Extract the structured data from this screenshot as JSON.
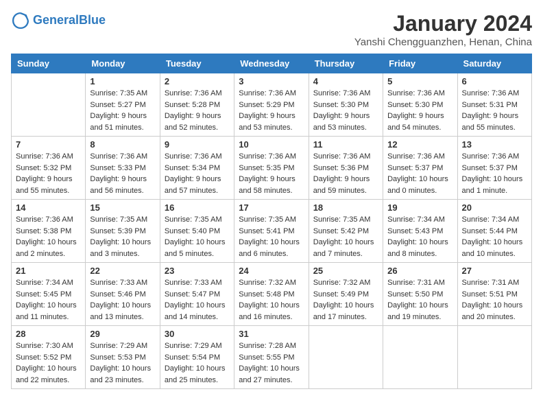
{
  "logo": {
    "text_general": "General",
    "text_blue": "Blue"
  },
  "title": "January 2024",
  "subtitle": "Yanshi Chengguanzhen, Henan, China",
  "days_of_week": [
    "Sunday",
    "Monday",
    "Tuesday",
    "Wednesday",
    "Thursday",
    "Friday",
    "Saturday"
  ],
  "weeks": [
    [
      {
        "day": "",
        "info": ""
      },
      {
        "day": "1",
        "info": "Sunrise: 7:35 AM\nSunset: 5:27 PM\nDaylight: 9 hours\nand 51 minutes."
      },
      {
        "day": "2",
        "info": "Sunrise: 7:36 AM\nSunset: 5:28 PM\nDaylight: 9 hours\nand 52 minutes."
      },
      {
        "day": "3",
        "info": "Sunrise: 7:36 AM\nSunset: 5:29 PM\nDaylight: 9 hours\nand 53 minutes."
      },
      {
        "day": "4",
        "info": "Sunrise: 7:36 AM\nSunset: 5:30 PM\nDaylight: 9 hours\nand 53 minutes."
      },
      {
        "day": "5",
        "info": "Sunrise: 7:36 AM\nSunset: 5:30 PM\nDaylight: 9 hours\nand 54 minutes."
      },
      {
        "day": "6",
        "info": "Sunrise: 7:36 AM\nSunset: 5:31 PM\nDaylight: 9 hours\nand 55 minutes."
      }
    ],
    [
      {
        "day": "7",
        "info": "Sunrise: 7:36 AM\nSunset: 5:32 PM\nDaylight: 9 hours\nand 55 minutes."
      },
      {
        "day": "8",
        "info": "Sunrise: 7:36 AM\nSunset: 5:33 PM\nDaylight: 9 hours\nand 56 minutes."
      },
      {
        "day": "9",
        "info": "Sunrise: 7:36 AM\nSunset: 5:34 PM\nDaylight: 9 hours\nand 57 minutes."
      },
      {
        "day": "10",
        "info": "Sunrise: 7:36 AM\nSunset: 5:35 PM\nDaylight: 9 hours\nand 58 minutes."
      },
      {
        "day": "11",
        "info": "Sunrise: 7:36 AM\nSunset: 5:36 PM\nDaylight: 9 hours\nand 59 minutes."
      },
      {
        "day": "12",
        "info": "Sunrise: 7:36 AM\nSunset: 5:37 PM\nDaylight: 10 hours\nand 0 minutes."
      },
      {
        "day": "13",
        "info": "Sunrise: 7:36 AM\nSunset: 5:37 PM\nDaylight: 10 hours\nand 1 minute."
      }
    ],
    [
      {
        "day": "14",
        "info": "Sunrise: 7:36 AM\nSunset: 5:38 PM\nDaylight: 10 hours\nand 2 minutes."
      },
      {
        "day": "15",
        "info": "Sunrise: 7:35 AM\nSunset: 5:39 PM\nDaylight: 10 hours\nand 3 minutes."
      },
      {
        "day": "16",
        "info": "Sunrise: 7:35 AM\nSunset: 5:40 PM\nDaylight: 10 hours\nand 5 minutes."
      },
      {
        "day": "17",
        "info": "Sunrise: 7:35 AM\nSunset: 5:41 PM\nDaylight: 10 hours\nand 6 minutes."
      },
      {
        "day": "18",
        "info": "Sunrise: 7:35 AM\nSunset: 5:42 PM\nDaylight: 10 hours\nand 7 minutes."
      },
      {
        "day": "19",
        "info": "Sunrise: 7:34 AM\nSunset: 5:43 PM\nDaylight: 10 hours\nand 8 minutes."
      },
      {
        "day": "20",
        "info": "Sunrise: 7:34 AM\nSunset: 5:44 PM\nDaylight: 10 hours\nand 10 minutes."
      }
    ],
    [
      {
        "day": "21",
        "info": "Sunrise: 7:34 AM\nSunset: 5:45 PM\nDaylight: 10 hours\nand 11 minutes."
      },
      {
        "day": "22",
        "info": "Sunrise: 7:33 AM\nSunset: 5:46 PM\nDaylight: 10 hours\nand 13 minutes."
      },
      {
        "day": "23",
        "info": "Sunrise: 7:33 AM\nSunset: 5:47 PM\nDaylight: 10 hours\nand 14 minutes."
      },
      {
        "day": "24",
        "info": "Sunrise: 7:32 AM\nSunset: 5:48 PM\nDaylight: 10 hours\nand 16 minutes."
      },
      {
        "day": "25",
        "info": "Sunrise: 7:32 AM\nSunset: 5:49 PM\nDaylight: 10 hours\nand 17 minutes."
      },
      {
        "day": "26",
        "info": "Sunrise: 7:31 AM\nSunset: 5:50 PM\nDaylight: 10 hours\nand 19 minutes."
      },
      {
        "day": "27",
        "info": "Sunrise: 7:31 AM\nSunset: 5:51 PM\nDaylight: 10 hours\nand 20 minutes."
      }
    ],
    [
      {
        "day": "28",
        "info": "Sunrise: 7:30 AM\nSunset: 5:52 PM\nDaylight: 10 hours\nand 22 minutes."
      },
      {
        "day": "29",
        "info": "Sunrise: 7:29 AM\nSunset: 5:53 PM\nDaylight: 10 hours\nand 23 minutes."
      },
      {
        "day": "30",
        "info": "Sunrise: 7:29 AM\nSunset: 5:54 PM\nDaylight: 10 hours\nand 25 minutes."
      },
      {
        "day": "31",
        "info": "Sunrise: 7:28 AM\nSunset: 5:55 PM\nDaylight: 10 hours\nand 27 minutes."
      },
      {
        "day": "",
        "info": ""
      },
      {
        "day": "",
        "info": ""
      },
      {
        "day": "",
        "info": ""
      }
    ]
  ]
}
